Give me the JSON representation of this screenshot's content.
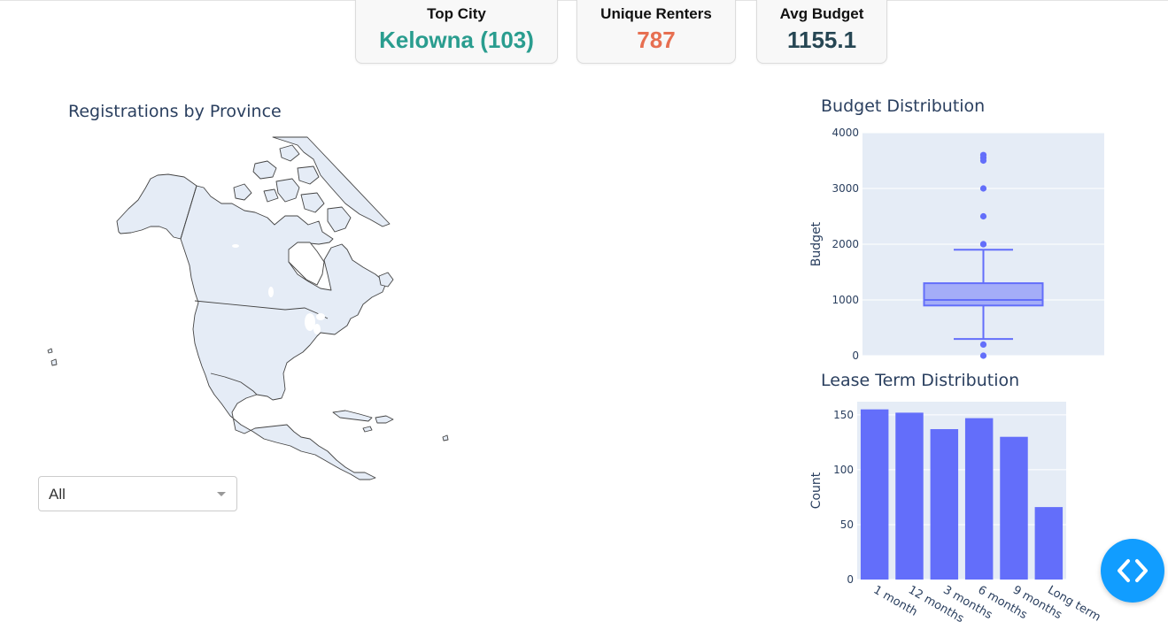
{
  "kpis": {
    "top_city": {
      "label": "Top City",
      "value": "Kelowna (103)",
      "color": "#2a9d8f"
    },
    "unique_renters": {
      "label": "Unique Renters",
      "value": "787",
      "color": "#e76f51"
    },
    "avg_budget": {
      "label": "Avg Budget",
      "value": "1155.1",
      "color": "#264653"
    }
  },
  "map": {
    "title": "Registrations by Province",
    "land_color": "#e5ecf6",
    "border_color": "#444444"
  },
  "filter": {
    "selected": "All",
    "icon": "chevron-down-icon"
  },
  "chart_data": [
    {
      "type": "box",
      "title": "Budget Distribution",
      "xlabel": "",
      "ylabel": "Budget",
      "ylim": [
        0,
        4000
      ],
      "yticks": [
        "0",
        "1000",
        "2000",
        "3000",
        "4000"
      ],
      "box": {
        "whisker_low": 300,
        "q1": 900,
        "median": 1000,
        "q3": 1300,
        "whisker_high": 1900
      },
      "outliers": [
        0,
        200,
        2000,
        2000,
        2500,
        3000,
        3500,
        3550,
        3600
      ],
      "color": "#636efa",
      "grid": true
    },
    {
      "type": "bar",
      "title": "Lease Term Distribution",
      "xlabel": "",
      "ylabel": "Count",
      "categories": [
        "1 month",
        "12 months",
        "3 months",
        "6 months",
        "9 months",
        "Long term"
      ],
      "values": [
        155,
        152,
        137,
        147,
        130,
        66
      ],
      "ylim": [
        0,
        162
      ],
      "yticks": [
        "0",
        "50",
        "100",
        "150"
      ],
      "color": "#636efa",
      "grid": true
    }
  ],
  "fab": {
    "icon": "code-brackets-icon"
  }
}
